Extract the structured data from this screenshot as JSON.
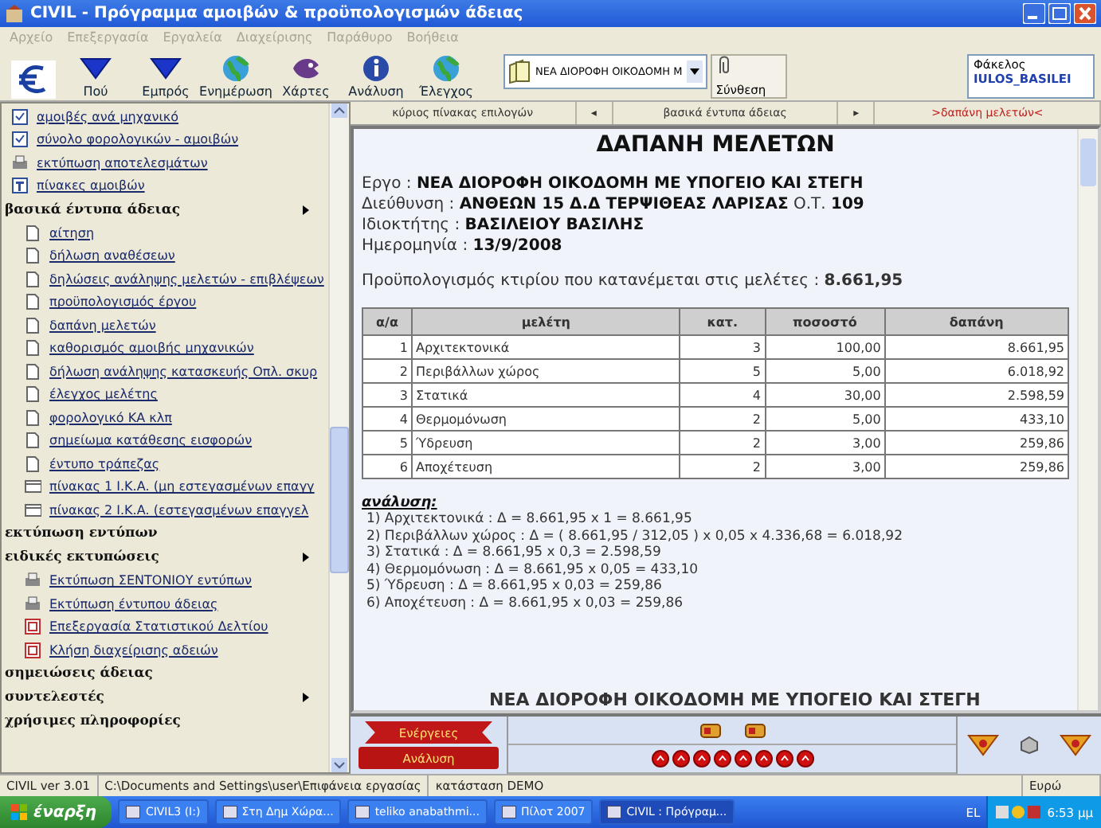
{
  "window": {
    "title": "CIVIL - Πρόγραμμα αμοιβών & προϋπολογισμών άδειας"
  },
  "menu": [
    "Αρχείο",
    "Επεξεργασία",
    "Εργαλεία",
    "Διαχείρισης",
    "Παράθυρο",
    "Βοήθεια"
  ],
  "toolbar": [
    {
      "kind": "logo"
    },
    {
      "kind": "arrow",
      "label": "Πού"
    },
    {
      "kind": "arrow",
      "label": "Εμπρός"
    },
    {
      "kind": "globe",
      "label": "Ενημέρωση"
    },
    {
      "kind": "mascot",
      "label": "Χάρτες"
    },
    {
      "kind": "info",
      "label": "Ανάλυση"
    },
    {
      "kind": "globe",
      "label": "Έλεγχος"
    }
  ],
  "project_select": {
    "value": "ΝΕΑ ΔΙΟΡΟΦΗ ΟΙΚΟΔΟΜΗ Μ"
  },
  "compose_button": {
    "label": "Σύνθεση"
  },
  "folder": {
    "label": "Φάκελος",
    "value": "IULOS_BASILEI"
  },
  "breadcrumb": {
    "home": "κύριος πίνακας επιλογών",
    "back": "◂",
    "section": "βασικά έντυπα άδειας",
    "forward": "▸",
    "current": ">δαπάνη μελετών<"
  },
  "sidebar": [
    {
      "kind": "checklist",
      "label": "αμοιβές ανά μηχανικό"
    },
    {
      "kind": "checklist",
      "label": "σύνολο φορολογικών - αμοιβών"
    },
    {
      "kind": "print",
      "label": "εκτύπωση αποτελεσμάτων"
    },
    {
      "kind": "table",
      "label": "πίνακες αμοιβών"
    },
    {
      "kind": "header",
      "label": "βασικά έντυπα άδειας",
      "has_submenu": true
    },
    {
      "kind": "page",
      "label": "αίτηση"
    },
    {
      "kind": "page",
      "label": "δήλωση αναθέσεων"
    },
    {
      "kind": "page",
      "label": "δηλώσεις ανάληψης μελετών - επιβλέψεων"
    },
    {
      "kind": "page",
      "label": "προϋπολογισμός έργου"
    },
    {
      "kind": "page",
      "label": "δαπάνη μελετών"
    },
    {
      "kind": "page",
      "label": "καθορισμός αμοιβής μηχανικών"
    },
    {
      "kind": "page",
      "label": "δήλωση ανάληψης κατασκευής Οπλ. σκυρ"
    },
    {
      "kind": "page",
      "label": "έλεγχος μελέτης"
    },
    {
      "kind": "page",
      "label": "φορολογικό ΚΑ κλπ"
    },
    {
      "kind": "page",
      "label": "σημείωμα κατάθεσης εισφορών"
    },
    {
      "kind": "page",
      "label": "έντυπο τράπεζας"
    },
    {
      "kind": "sheet",
      "label": "πίνακας 1 Ι.Κ.Α. (μη εστεγασμένων επαγγ"
    },
    {
      "kind": "sheet",
      "label": "πίνακας 2 Ι.Κ.Α. (εστεγασμένων επαγγελ"
    },
    {
      "kind": "header",
      "label": "εκτύπωση εντύπων",
      "has_submenu": false
    },
    {
      "kind": "header",
      "label": "ειδικές εκτυπώσεις",
      "has_submenu": true
    },
    {
      "kind": "print",
      "label": "Εκτύπωση ΣΕΝΤΟΝΙΟΥ εντύπων"
    },
    {
      "kind": "print",
      "label": "Εκτύπωση έντυπου άδειας"
    },
    {
      "kind": "form",
      "label": "Επεξεργασία Στατιστικού Δελτίου"
    },
    {
      "kind": "form",
      "label": "Κλήση διαχείρισης αδειών"
    },
    {
      "kind": "header",
      "label": "σημειώσεις άδειας",
      "has_submenu": false
    },
    {
      "kind": "header",
      "label": "συντελεστές",
      "has_submenu": true
    },
    {
      "kind": "header",
      "label": "χρήσιμες πληροφορίες",
      "has_submenu": false
    }
  ],
  "document": {
    "title": "ΔΑΠΑΝΗ ΜΕΛΕΤΩΝ",
    "fields": [
      "Εργο : **ΝΕΑ ΔΙΟΡΟΦΗ ΟΙΚΟΔΟΜΗ ΜΕ ΥΠΟΓΕΙΟ ΚΑΙ ΣΤΕΓΗ**",
      "Διεύθυνση : **ΑΝΘΕΩΝ 15 Δ.Δ ΤΕΡΨΙΘΕΑΣ ΛΑΡΙΣΑΣ** Ο.Τ. **109**",
      "Ιδιοκτήτης : **ΒΑΣΙΛΕΙΟΥ ΒΑΣΙΛΗΣ**",
      "Ημερομηνία : **13/9/2008**"
    ],
    "budget": "Προϋπολογισμός κτιρίου που κατανέμεται στις μελέτες : **8.661,95**",
    "table": {
      "columns": [
        "α/α",
        "μελέτη",
        "κατ.",
        "ποσοστό",
        "δαπάνη"
      ],
      "rows": [
        [
          "1",
          "Αρχιτεκτονικά",
          "3",
          "100,00",
          "8.661,95"
        ],
        [
          "2",
          "Περιβάλλων χώρος",
          "5",
          "5,00",
          "6.018,92"
        ],
        [
          "3",
          "Στατικά",
          "4",
          "30,00",
          "2.598,59"
        ],
        [
          "4",
          "Θερμομόνωση",
          "2",
          "5,00",
          "433,10"
        ],
        [
          "5",
          "Ύδρευση",
          "2",
          "3,00",
          "259,86"
        ],
        [
          "6",
          "Αποχέτευση",
          "2",
          "3,00",
          "259,86"
        ]
      ]
    },
    "analysis_title": "ανάλυση:",
    "analysis": [
      "1) Αρχιτεκτονικά : Δ = 8.661,95 x 1 = 8.661,95",
      "2) Περιβάλλων χώρος : Δ = ( 8.661,95 / 312,05 ) x 0,05 x 4.336,68 = 6.018,92",
      "3) Στατικά : Δ = 8.661,95 x 0,3 = 2.598,59",
      "4) Θερμομόνωση : Δ = 8.661,95 x 0,05 = 433,10",
      "5) Ύδρευση : Δ = 8.661,95 x 0,03 = 259,86",
      "6) Αποχέτευση : Δ = 8.661,95 x 0,03 = 259,86"
    ],
    "footer_line": "ΝΕΑ ΔΙΟΡΟΦΗ ΟΙΚΟΔΟΜΗ ΜΕ ΥΠΟΓΕΙΟ ΚΑΙ ΣΤΕΓΗ"
  },
  "actions": [
    "Ενέργειες",
    "Ανάλυση"
  ],
  "status_bar": [
    "CIVIL ver 3.01",
    "C:\\Documents and Settings\\user\\Επιφάνεια εργασίας",
    "κατάσταση DEMO",
    "Ευρώ"
  ],
  "taskbar": {
    "start": "έναρξη",
    "tasks": [
      {
        "label": "CIVIL3 (I:)",
        "selected": false
      },
      {
        "label": "Στη Δημ Χώρα...",
        "selected": false
      },
      {
        "label": "teliko anabathmi...",
        "selected": false
      },
      {
        "label": "Πίλοτ 2007",
        "selected": false
      },
      {
        "label": "CIVIL : Πρόγραμ...",
        "selected": true
      }
    ],
    "lang": "EL",
    "clock": "6:53 μμ"
  }
}
